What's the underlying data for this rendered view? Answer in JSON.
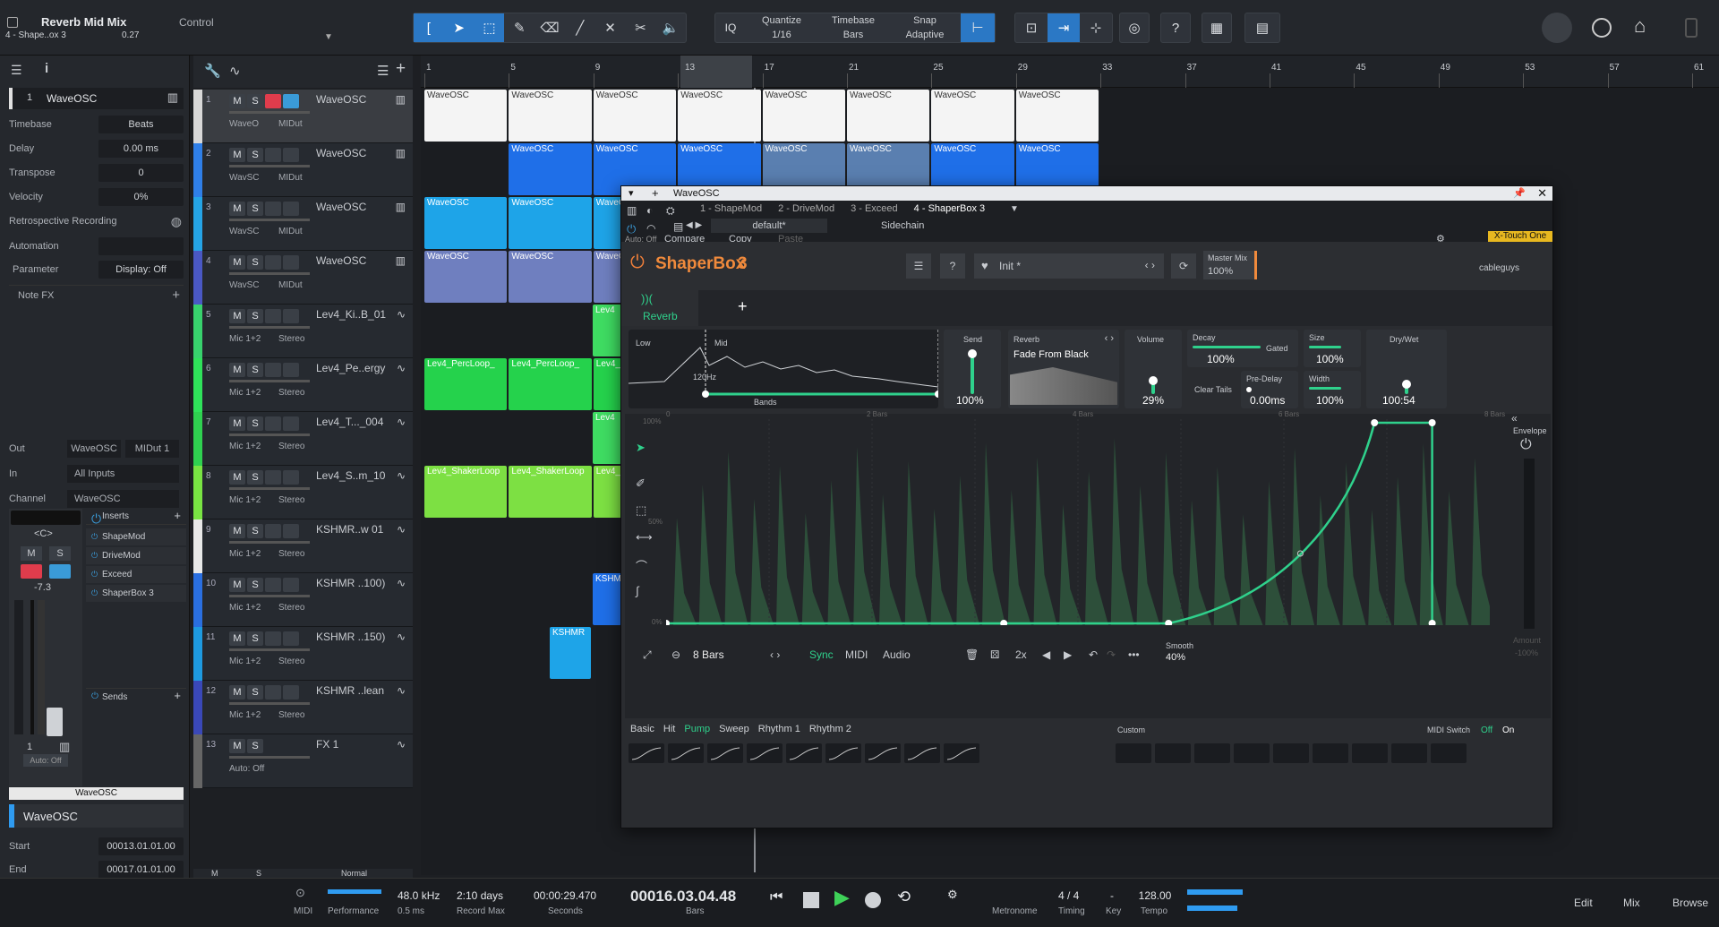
{
  "song": {
    "title": "Reverb Mid Mix",
    "subtitle": "4 - Shape..ox 3",
    "value": "0.27",
    "control_label": "Control"
  },
  "toolbar": {
    "quantize_label": "Quantize",
    "quantize_value": "1/16",
    "timebase_label": "Timebase",
    "timebase_value": "Bars",
    "snap_label": "Snap",
    "snap_value": "Adaptive",
    "iq": "IQ",
    "help": "?"
  },
  "inspector": {
    "track_num": "1",
    "track_name": "WaveOSC",
    "rows": [
      {
        "label": "Timebase",
        "value": "Beats"
      },
      {
        "label": "Delay",
        "value": "0.00 ms"
      },
      {
        "label": "Transpose",
        "value": "0"
      },
      {
        "label": "Velocity",
        "value": "0%"
      }
    ],
    "retro": "Retrospective Recording",
    "automation": "Automation",
    "parameter": "Parameter",
    "display": "Display: Off",
    "notefx": "Note FX",
    "out_label": "Out",
    "out_value": "WaveOSC",
    "out_midi": "MIDut 1",
    "in_label": "In",
    "in_value": "All Inputs",
    "channel_label": "Channel",
    "channel_value": "WaveOSC",
    "inserts_label": "Inserts",
    "inserts": [
      "ShapeMod",
      "DriveMod",
      "Exceed",
      "ShaperBox 3"
    ],
    "sends_label": "Sends",
    "fader_value": "-7.3",
    "channel_num": "1",
    "auto": "Auto: Off",
    "channel_name": "WaveOSC",
    "event_name": "WaveOSC",
    "start_label": "Start",
    "start_value": "00013.01.01.00",
    "end_label": "End",
    "end_value": "00017.01.01.00"
  },
  "tracks": [
    {
      "n": "1",
      "name": "WaveOSC",
      "sub1": "WaveO",
      "sub2": "MIDut",
      "color": "#d8d8d8"
    },
    {
      "n": "2",
      "name": "WaveOSC",
      "sub1": "WavSC",
      "sub2": "MIDut",
      "color": "#2f7fe8"
    },
    {
      "n": "3",
      "name": "WaveOSC",
      "sub1": "WavSC",
      "sub2": "MIDut",
      "color": "#25a4e6"
    },
    {
      "n": "4",
      "name": "WaveOSC",
      "sub1": "WavSC",
      "sub2": "MIDut",
      "color": "#4a58c4"
    },
    {
      "n": "5",
      "name": "Lev4_Ki..B_01",
      "sub1": "Mic 1+2",
      "sub2": "Stereo",
      "color": "#38d26d"
    },
    {
      "n": "6",
      "name": "Lev4_Pe..ergy",
      "sub1": "Mic 1+2",
      "sub2": "Stereo",
      "color": "#2fe25a"
    },
    {
      "n": "7",
      "name": "Lev4_T..._004",
      "sub1": "Mic 1+2",
      "sub2": "Stereo",
      "color": "#2fd150"
    },
    {
      "n": "8",
      "name": "Lev4_S..m_10",
      "sub1": "Mic 1+2",
      "sub2": "Stereo",
      "color": "#79e343"
    },
    {
      "n": "9",
      "name": "KSHMR..w 01",
      "sub1": "Mic 1+2",
      "sub2": "Stereo",
      "color": "#e8e8e8"
    },
    {
      "n": "10",
      "name": "KSHMR ..100)",
      "sub1": "Mic 1+2",
      "sub2": "Stereo",
      "color": "#2a6fe0"
    },
    {
      "n": "11",
      "name": "KSHMR ..150)",
      "sub1": "Mic 1+2",
      "sub2": "Stereo",
      "color": "#1e9ae0"
    },
    {
      "n": "12",
      "name": "KSHMR ..lean",
      "sub1": "Mic 1+2",
      "sub2": "Stereo",
      "color": "#3a48b8"
    },
    {
      "n": "13",
      "name": "FX 1",
      "sub1": "Auto: Off",
      "sub2": "",
      "color": "#666"
    }
  ],
  "ruler": [
    "1",
    "5",
    "9",
    "13",
    "17",
    "21",
    "25",
    "29",
    "33",
    "37",
    "41",
    "45",
    "49",
    "53",
    "57",
    "61"
  ],
  "clips": {
    "wave": "WaveOSC",
    "perc": "Lev4_PercLoop_",
    "shaker": "Lev4_ShakerLoop",
    "kshmr": "KSHMR",
    "lev4": "Lev4"
  },
  "plugin": {
    "window_title": "WaveOSC",
    "slots": [
      "1 - ShapeMod",
      "2 - DriveMod",
      "3 - Exceed",
      "4 - ShaperBox 3"
    ],
    "preset": "default*",
    "sidechain": "Sidechain",
    "auto": "Auto: Off",
    "compare": "Compare",
    "copy": "Copy",
    "paste": "Paste",
    "controller": "X-Touch One",
    "brand": "ShaperBox",
    "brand_num": "3",
    "patch": "Init *",
    "master_mix_label": "Master Mix",
    "master_mix": "100%",
    "vendor": "cableguys",
    "tab": "Reverb",
    "plus": "+",
    "bands": {
      "low": "Low",
      "mid": "Mid",
      "freq": "120Hz",
      "label": "Bands"
    },
    "send": {
      "label": "Send",
      "value": "100%"
    },
    "reverb": {
      "label": "Reverb",
      "preset": "Fade From Black"
    },
    "volume": {
      "label": "Volume",
      "value": "29%"
    },
    "decay": {
      "label": "Decay",
      "value": "100%",
      "gated": "Gated"
    },
    "size": {
      "label": "Size",
      "value": "100%"
    },
    "drywet": {
      "label": "Dry/Wet",
      "value": "100:54"
    },
    "clear_tails": "Clear Tails",
    "predelay": {
      "label": "Pre-Delay",
      "value": "0.00ms"
    },
    "width": {
      "label": "Width",
      "value": "100%"
    },
    "grid": {
      "y100": "100%",
      "y50": "50%",
      "y0": "0%",
      "x0": "0",
      "x2": "2 Bars",
      "x4": "4 Bars",
      "x6": "6 Bars",
      "x8": "8 Bars"
    },
    "envelope": "Envelope",
    "amount": "Amount",
    "amount_val": "-100%",
    "bottom": {
      "length": "8 Bars",
      "sync": "Sync",
      "midi": "MIDI",
      "audio": "Audio",
      "mult": "2x",
      "smooth_label": "Smooth",
      "smooth": "40%"
    },
    "shape_tabs": [
      "Basic",
      "Hit",
      "Pump",
      "Sweep",
      "Rhythm 1",
      "Rhythm 2"
    ],
    "custom": "Custom",
    "midi_switch": "MIDI Switch",
    "off": "Off",
    "on": "On",
    "accent": "#2fd18c"
  },
  "transport": {
    "midi": "MIDI",
    "performance": "Performance",
    "rate": "48.0 kHz",
    "latency": "0.5 ms",
    "days": "2:10 days",
    "record_max": "Record Max",
    "seconds_val": "00:00:29.470",
    "seconds": "Seconds",
    "bars_val": "00016.03.04.48",
    "bars": "Bars",
    "metronome": "Metronome",
    "timing_val": "4 / 4",
    "timing": "Timing",
    "key_val": "-",
    "key": "Key",
    "tempo_val": "128.00",
    "tempo": "Tempo"
  },
  "bottom_tabs": [
    "Edit",
    "Mix",
    "Browse"
  ],
  "mixbar": {
    "m": "M",
    "s": "S",
    "normal": "Normal"
  }
}
